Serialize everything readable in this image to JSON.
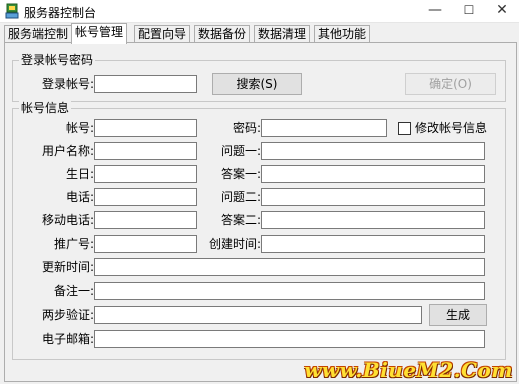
{
  "window": {
    "title": "服务器控制台",
    "min": "—",
    "max": "☐",
    "close": "✕"
  },
  "tabs": [
    {
      "label": "服务端控制"
    },
    {
      "label": "帐号管理"
    },
    {
      "label": "配置向导"
    },
    {
      "label": "数据备份"
    },
    {
      "label": "数据清理"
    },
    {
      "label": "其他功能"
    }
  ],
  "login_group": {
    "title": "登录帐号密码",
    "account_label": "登录帐号:",
    "account_value": "",
    "search_label": "搜索(S)",
    "confirm_label": "确定(O)"
  },
  "info_group": {
    "title": "帐号信息",
    "account_label": "帐号:",
    "password_label": "密码:",
    "modify_label": "修改帐号信息",
    "username_label": "用户名称:",
    "question1_label": "问题一:",
    "birthday_label": "生日:",
    "answer1_label": "答案一:",
    "phone_label": "电话:",
    "question2_label": "问题二:",
    "mobile_label": "移动电话:",
    "answer2_label": "答案二:",
    "promoter_label": "推广号:",
    "created_label": "创建时间:",
    "updated_label": "更新时间:",
    "note1_label": "备注一:",
    "twostep_label": "两步验证:",
    "generate_label": "生成",
    "email_label": "电子邮箱:"
  },
  "watermark": "www.BiueM2.Com"
}
